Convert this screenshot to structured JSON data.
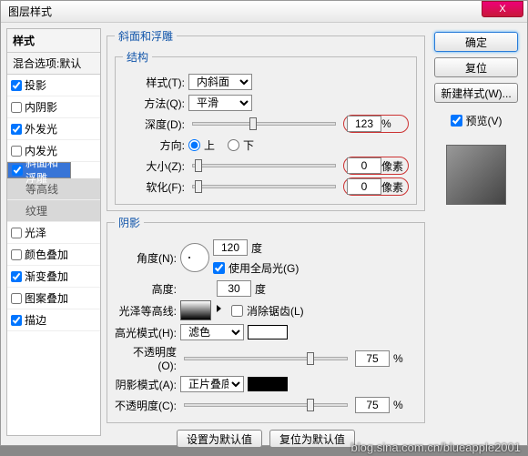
{
  "window": {
    "title": "图层样式"
  },
  "close_x": "X",
  "left": {
    "header": "样式",
    "subheader": "混合选项:默认",
    "items": [
      {
        "label": "投影",
        "checked": true,
        "sel": false
      },
      {
        "label": "内阴影",
        "checked": false,
        "sel": false
      },
      {
        "label": "外发光",
        "checked": true,
        "sel": false
      },
      {
        "label": "内发光",
        "checked": false,
        "sel": false
      },
      {
        "label": "斜面和浮雕",
        "checked": true,
        "sel": true
      },
      {
        "label": "等高线",
        "sub": true
      },
      {
        "label": "纹理",
        "sub": true
      },
      {
        "label": "光泽",
        "checked": false,
        "sel": false
      },
      {
        "label": "颜色叠加",
        "checked": false,
        "sel": false
      },
      {
        "label": "渐变叠加",
        "checked": true,
        "sel": false
      },
      {
        "label": "图案叠加",
        "checked": false,
        "sel": false
      },
      {
        "label": "描边",
        "checked": true,
        "sel": false
      }
    ]
  },
  "main": {
    "group_title": "斜面和浮雕",
    "structure": {
      "legend": "结构",
      "style_label": "样式(T):",
      "style_value": "内斜面",
      "technique_label": "方法(Q):",
      "technique_value": "平滑",
      "depth_label": "深度(D):",
      "depth_value": "123",
      "depth_unit": "%",
      "direction_label": "方向:",
      "up": "上",
      "down": "下",
      "size_label": "大小(Z):",
      "size_value": "0",
      "size_unit": "像素",
      "soften_label": "软化(F):",
      "soften_value": "0",
      "soften_unit": "像素"
    },
    "shadow": {
      "legend": "阴影",
      "angle_label": "角度(N):",
      "angle_value": "120",
      "angle_unit": "度",
      "global_label": "使用全局光(G)",
      "global_checked": true,
      "altitude_label": "高度:",
      "altitude_value": "30",
      "altitude_unit": "度",
      "gloss_label": "光泽等高线:",
      "antialias_label": "消除锯齿(L)",
      "hi_mode_label": "高光模式(H):",
      "hi_mode_value": "滤色",
      "hi_opacity_label": "不透明度(O):",
      "hi_opacity_value": "75",
      "opacity_unit": "%",
      "sh_mode_label": "阴影模式(A):",
      "sh_mode_value": "正片叠底",
      "sh_opacity_label": "不透明度(C):",
      "sh_opacity_value": "75"
    },
    "set_default": "设置为默认值",
    "reset_default": "复位为默认值"
  },
  "right": {
    "ok": "确定",
    "cancel": "复位",
    "new_style": "新建样式(W)...",
    "preview_label": "预览(V)",
    "preview_checked": true
  },
  "watermark": "blog.sina.com.cn/blueapple2001"
}
